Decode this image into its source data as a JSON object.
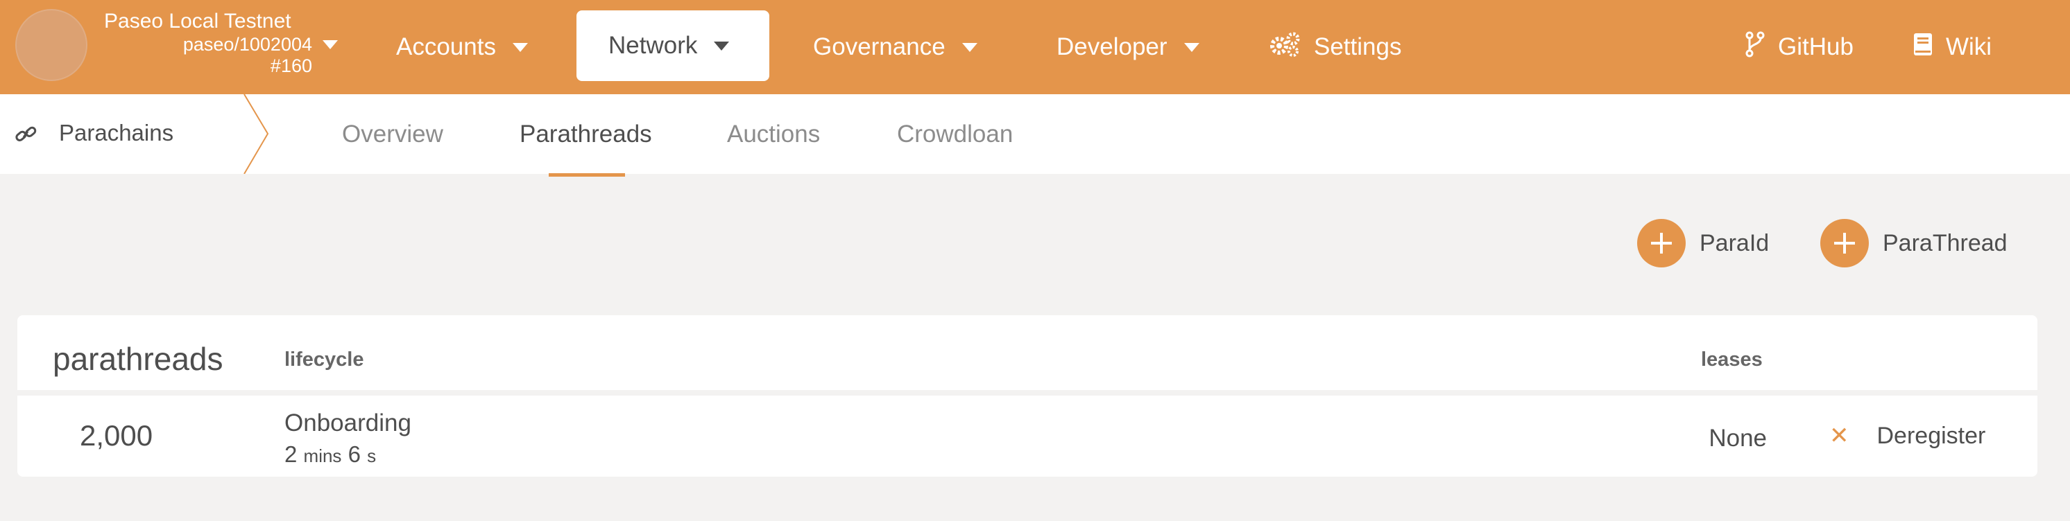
{
  "chain": {
    "name": "Paseo Local Testnet",
    "runtime": "paseo/1002004",
    "block": "#160"
  },
  "menu": {
    "accounts": "Accounts",
    "network": "Network",
    "governance": "Governance",
    "developer": "Developer",
    "settings": "Settings",
    "github": "GitHub",
    "wiki": "Wiki"
  },
  "subnav": {
    "section": "Parachains",
    "tabs": [
      "Overview",
      "Parathreads",
      "Auctions",
      "Crowdloan"
    ],
    "active_tab": "Parathreads"
  },
  "actions": {
    "add_paraid": "ParaId",
    "add_parathread": "ParaThread"
  },
  "table": {
    "title": "parathreads",
    "columns": {
      "lifecycle": "lifecycle",
      "leases": "leases"
    },
    "rows": [
      {
        "id": "2,000",
        "state": "Onboarding",
        "time_mins": "2",
        "time_mins_unit": "mins",
        "time_secs": "6",
        "time_secs_unit": "s",
        "leases": "None",
        "action": "Deregister"
      }
    ]
  },
  "colors": {
    "accent": "#e4954b",
    "background": "#f3f2f1",
    "text": "#4e4e4e"
  }
}
